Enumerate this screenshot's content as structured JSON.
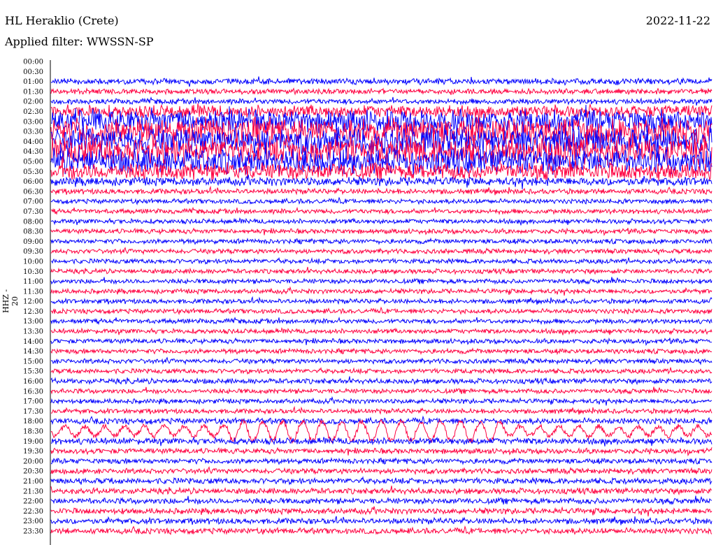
{
  "header": {
    "station": "HL Heraklio (Crete)",
    "filter": "Applied filter: WWSSN-SP",
    "date": "2022-11-22"
  },
  "chart_data": {
    "type": "line",
    "title": "HL Heraklio (Crete)",
    "ylabel": "HHZ - 20",
    "colors": [
      "#0000ff",
      "#ff0040"
    ],
    "rows": [
      {
        "label": "00:00",
        "amp": 0
      },
      {
        "label": "00:30",
        "amp": 0
      },
      {
        "label": "01:00",
        "amp": 0.55
      },
      {
        "label": "01:30",
        "amp": 0.5
      },
      {
        "label": "02:00",
        "amp": 0.5
      },
      {
        "label": "02:30",
        "amp": 1.2
      },
      {
        "label": "03:00",
        "amp": 2.2
      },
      {
        "label": "03:30",
        "amp": 2.6
      },
      {
        "label": "04:00",
        "amp": 2.6
      },
      {
        "label": "04:30",
        "amp": 2.6
      },
      {
        "label": "05:00",
        "amp": 2.4
      },
      {
        "label": "05:30",
        "amp": 1.6
      },
      {
        "label": "06:00",
        "amp": 0.8
      },
      {
        "label": "06:30",
        "amp": 0.5
      },
      {
        "label": "07:00",
        "amp": 0.45
      },
      {
        "label": "07:30",
        "amp": 0.45
      },
      {
        "label": "08:00",
        "amp": 0.45
      },
      {
        "label": "08:30",
        "amp": 0.45
      },
      {
        "label": "09:00",
        "amp": 0.45
      },
      {
        "label": "09:30",
        "amp": 0.45
      },
      {
        "label": "10:00",
        "amp": 0.45
      },
      {
        "label": "10:30",
        "amp": 0.45
      },
      {
        "label": "11:00",
        "amp": 0.45
      },
      {
        "label": "11:30",
        "amp": 0.45
      },
      {
        "label": "12:00",
        "amp": 0.45
      },
      {
        "label": "12:30",
        "amp": 0.45
      },
      {
        "label": "13:00",
        "amp": 0.45
      },
      {
        "label": "13:30",
        "amp": 0.45
      },
      {
        "label": "14:00",
        "amp": 0.45
      },
      {
        "label": "14:30",
        "amp": 0.45
      },
      {
        "label": "15:00",
        "amp": 0.45
      },
      {
        "label": "15:30",
        "amp": 0.45
      },
      {
        "label": "16:00",
        "amp": 0.5
      },
      {
        "label": "16:30",
        "amp": 0.45
      },
      {
        "label": "17:00",
        "amp": 0.45
      },
      {
        "label": "17:30",
        "amp": 0.45
      },
      {
        "label": "18:00",
        "amp": 0.55
      },
      {
        "label": "18:30",
        "amp": 1.2
      },
      {
        "label": "19:00",
        "amp": 0.6
      },
      {
        "label": "19:30",
        "amp": 0.5
      },
      {
        "label": "20:00",
        "amp": 0.5
      },
      {
        "label": "20:30",
        "amp": 0.5
      },
      {
        "label": "21:00",
        "amp": 0.55
      },
      {
        "label": "21:30",
        "amp": 0.55
      },
      {
        "label": "22:00",
        "amp": 0.55
      },
      {
        "label": "22:30",
        "amp": 0.55
      },
      {
        "label": "23:00",
        "amp": 0.55
      },
      {
        "label": "23:30",
        "amp": 0.55
      }
    ]
  }
}
